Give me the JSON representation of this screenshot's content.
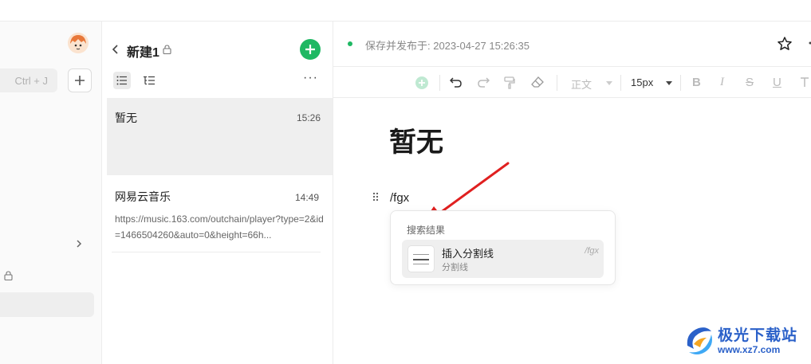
{
  "sidebar": {
    "search_hint": "Ctrl + J"
  },
  "notebook": {
    "title": "新建1"
  },
  "notes": [
    {
      "title": "暂无",
      "time": "15:26",
      "preview": ""
    },
    {
      "title": "网易云音乐",
      "time": "14:49",
      "preview": "https://music.163.com/outchain/player?type=2&id=1466504260&auto=0&height=66h..."
    }
  ],
  "editor": {
    "status": "保存并发布于: 2023-04-27 15:26:35",
    "toolbar": {
      "paragraph_style": "正文",
      "font_size": "15px"
    },
    "doc_title": "暂无",
    "command_text": "/fgx"
  },
  "popup": {
    "heading": "搜索结果",
    "item_title": "插入分割线",
    "item_subtitle": "分割线",
    "item_shortcut": "/fgx"
  },
  "watermark": {
    "title": "极光下载站",
    "url": "www.xz7.com"
  },
  "colors": {
    "accent_green": "#1fb863",
    "arrow_red": "#e02020",
    "watermark_blue": "#2b61c9"
  }
}
